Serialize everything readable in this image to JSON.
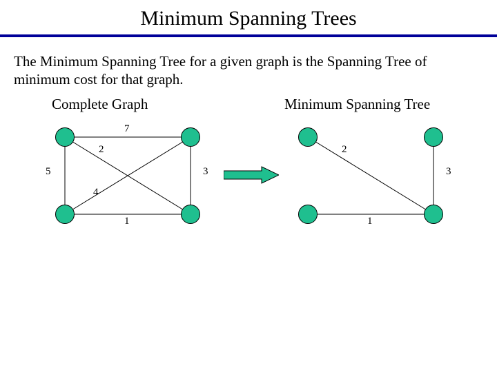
{
  "title": "Minimum Spanning Trees",
  "body": "The Minimum Spanning Tree for a given graph is the Spanning Tree of minimum cost for that graph.",
  "left": {
    "caption": "Complete Graph",
    "edges": {
      "top": "7",
      "diag_tl_br": "2",
      "left": "5",
      "right": "3",
      "diag_tr_bl": "4",
      "bottom": "1"
    }
  },
  "right": {
    "caption": "Minimum Spanning Tree",
    "edges": {
      "diag_tl_br": "2",
      "right": "3",
      "bottom": "1"
    }
  }
}
